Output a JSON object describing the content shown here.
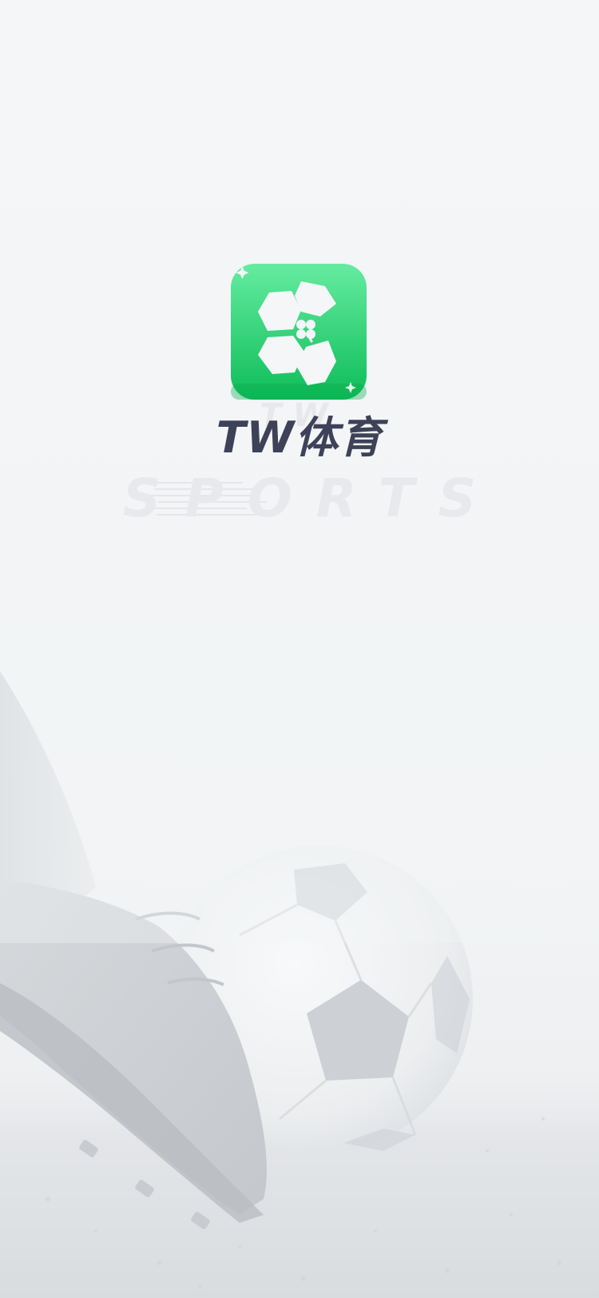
{
  "app": {
    "name": "TW体育",
    "ghost": "TW",
    "tagline": "SPORTS"
  },
  "logo": {
    "icon": "soccer-ball-clover-icon",
    "gradient_top": "#5ee89a",
    "gradient_bottom": "#0fbf5c"
  },
  "background": {
    "icon": "soccer-boot-and-ball-image",
    "base_color": "#f3f5f7"
  }
}
